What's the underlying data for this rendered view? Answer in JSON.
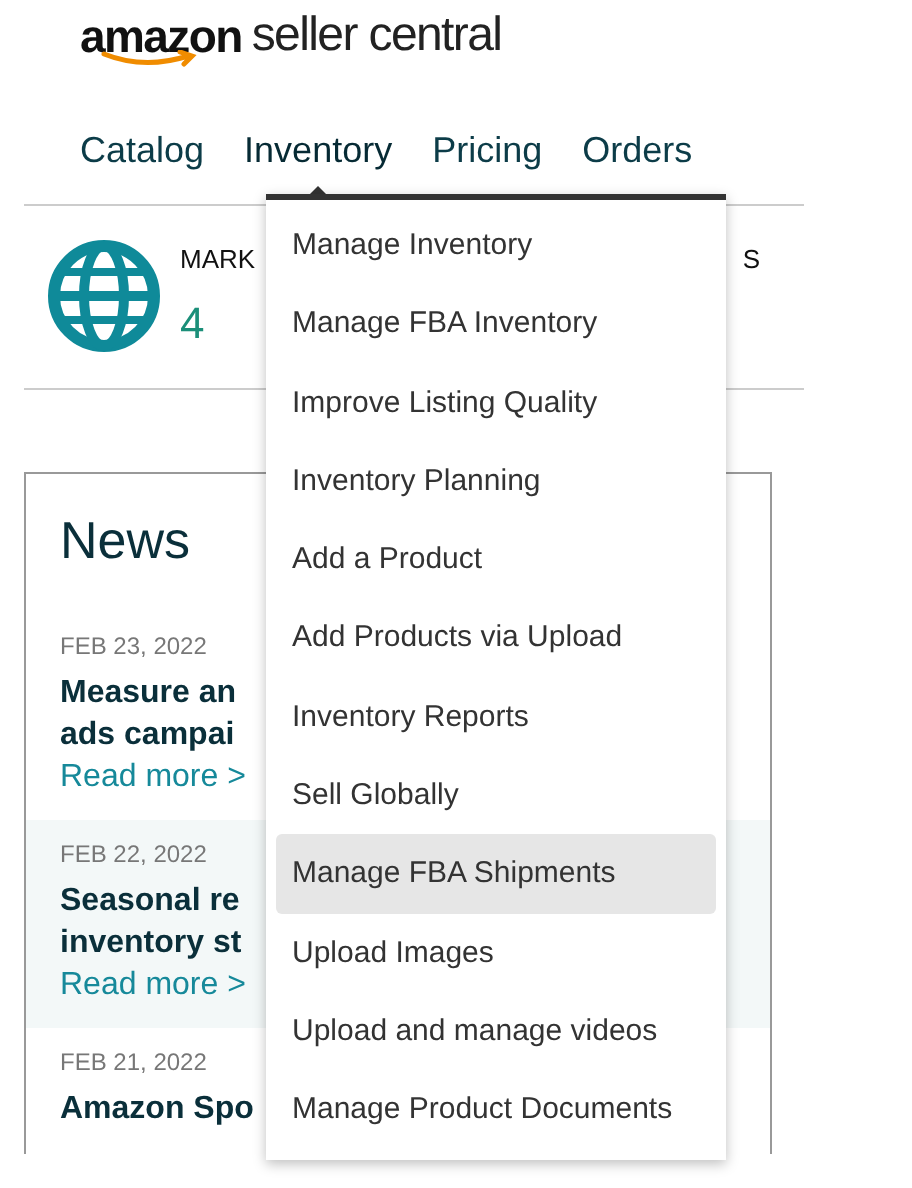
{
  "logo": {
    "brand": "amazon",
    "product": "seller central"
  },
  "nav": [
    {
      "label": "Catalog",
      "selected": false
    },
    {
      "label": "Inventory",
      "selected": true
    },
    {
      "label": "Pricing",
      "selected": false
    },
    {
      "label": "Orders",
      "selected": false
    }
  ],
  "menu": [
    {
      "label": "Manage Inventory",
      "selected": false
    },
    {
      "label": "Manage FBA Inventory",
      "selected": false
    },
    {
      "label": "Improve Listing Quality",
      "selected": false
    },
    {
      "label": "Inventory Planning",
      "selected": false
    },
    {
      "label": "Add a Product",
      "selected": false
    },
    {
      "label": "Add Products via Upload",
      "selected": false
    },
    {
      "label": "Inventory Reports",
      "selected": false
    },
    {
      "label": "Sell Globally",
      "selected": false
    },
    {
      "label": "Manage FBA Shipments",
      "selected": true
    },
    {
      "label": "Upload Images",
      "selected": false
    },
    {
      "label": "Upload and manage videos",
      "selected": false
    },
    {
      "label": "Manage Product Documents",
      "selected": false
    }
  ],
  "summary": {
    "label": "MARK",
    "label_2": "S",
    "value": "4"
  },
  "news": {
    "title": "News",
    "items": [
      {
        "date": "FEB 23, 2022",
        "headline": [
          "Measure an",
          "ads campai"
        ],
        "link": "Read more >",
        "highlighted": false
      },
      {
        "date": "FEB 22, 2022",
        "headline": [
          "Seasonal re",
          "inventory st"
        ],
        "link": "Read more >",
        "highlighted": true
      },
      {
        "date": "FEB 21, 2022",
        "headline": [
          "Amazon Spo"
        ],
        "highlighted": false
      }
    ]
  }
}
